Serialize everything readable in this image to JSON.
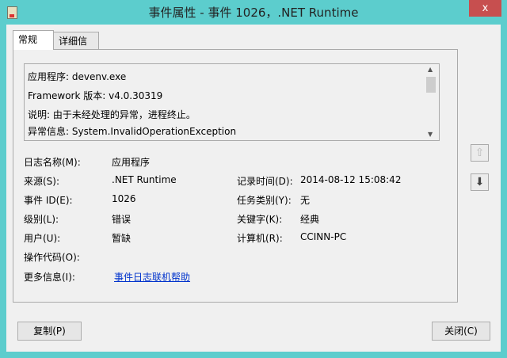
{
  "window": {
    "title": "事件属性 - 事件 1026，.NET Runtime",
    "close": "x"
  },
  "tabs": [
    {
      "label": "常规"
    },
    {
      "label": "详细信息"
    }
  ],
  "description": [
    "应用程序: devenv.exe",
    "Framework 版本: v4.0.30319",
    "说明: 由于未经处理的异常，进程终止。",
    "异常信息: System.InvalidOperationException"
  ],
  "fields": {
    "log_name": {
      "label": "日志名称(M):",
      "value": "应用程序"
    },
    "source": {
      "label": "来源(S):",
      "value": ".NET Runtime"
    },
    "logged": {
      "label": "记录时间(D):",
      "value": "2014-08-12 15:08:42"
    },
    "event_id": {
      "label": "事件 ID(E):",
      "value": "1026"
    },
    "task_category": {
      "label": "任务类别(Y):",
      "value": "无"
    },
    "level": {
      "label": "级别(L):",
      "value": "错误"
    },
    "keywords": {
      "label": "关键字(K):",
      "value": "经典"
    },
    "user": {
      "label": "用户(U):",
      "value": "暂缺"
    },
    "computer": {
      "label": "计算机(R):",
      "value": "CCINN-PC"
    },
    "opcode": {
      "label": "操作代码(O):",
      "value": ""
    },
    "more_info": {
      "label": "更多信息(I):",
      "value": "事件日志联机帮助"
    }
  },
  "buttons": {
    "copy": "复制(P)",
    "close": "关闭(C)",
    "up": "⇧",
    "down": "⬇"
  }
}
